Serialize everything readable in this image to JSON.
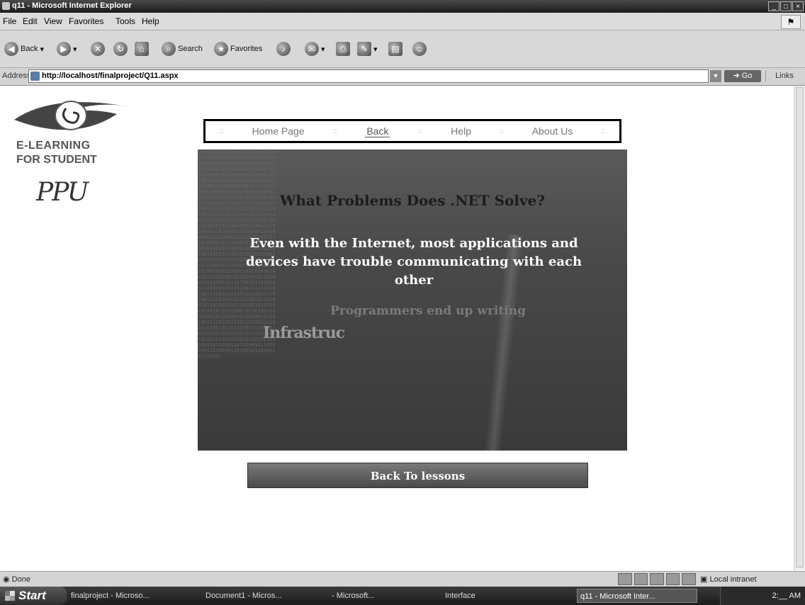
{
  "window": {
    "title": "q11 - Microsoft Internet Explorer",
    "controls": [
      "_",
      "□",
      "×"
    ]
  },
  "menu": [
    "File",
    "Edit",
    "View",
    "Favorites",
    "Tools",
    "Help"
  ],
  "toolbar": {
    "back_label": "Back",
    "search_label": "Search",
    "favorites_label": "Favorites"
  },
  "address": {
    "label": "Address",
    "url": "http://localhost/finalproject/Q11.aspx",
    "go_label": "Go",
    "links_label": "Links"
  },
  "sidebar_logo": {
    "line1": "E-LEARNING",
    "line2": "FOR STUDENT",
    "ppu": "PPU"
  },
  "nav": {
    "sep": "::",
    "items": [
      {
        "label": "Home Page"
      },
      {
        "label": "Back"
      },
      {
        "label": "Help"
      },
      {
        "label": "About Us"
      }
    ]
  },
  "slide": {
    "title": "What Problems Does .NET Solve?",
    "body": "Even with the Internet, most applications and devices have trouble communicating with each other",
    "sub": "Programmers end up writing",
    "fragment": "Infrastruc"
  },
  "back_button": "Back To lessons",
  "status": {
    "text": "Done",
    "zone": "Local intranet"
  },
  "taskbar": {
    "start": "Start",
    "tasks": [
      "finalproject - Microso...",
      "Document1 - Micros...",
      "- Microsoft...",
      "Interface",
      "q11 - Microsoft Inter..."
    ],
    "tray_time": "2:__ AM"
  }
}
